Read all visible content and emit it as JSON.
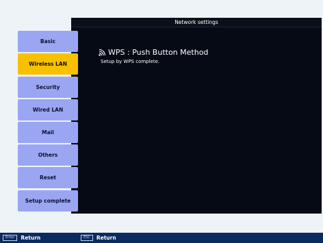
{
  "header": {
    "title": "Network settings"
  },
  "sidebar": {
    "items": [
      {
        "label": "Basic"
      },
      {
        "label": "Wireless LAN"
      },
      {
        "label": "Security"
      },
      {
        "label": "Wired LAN"
      },
      {
        "label": "Mail"
      },
      {
        "label": "Others"
      },
      {
        "label": "Reset"
      },
      {
        "label": "Setup complete"
      }
    ],
    "selected": "Wireless LAN"
  },
  "main": {
    "wps_title": "WPS : Push Button Method",
    "status_message": "Setup by WPS complete.",
    "icon": "wireless-signal-icon"
  },
  "footer": {
    "hints": [
      {
        "key": "Enter",
        "label": "Return"
      },
      {
        "key": "ESC",
        "label": "Return"
      }
    ]
  },
  "colors": {
    "sidebar_button": "#9aa6f2",
    "sidebar_selected": "#f7c100",
    "panel": "#060a14",
    "footer": "#0a2b5f"
  }
}
